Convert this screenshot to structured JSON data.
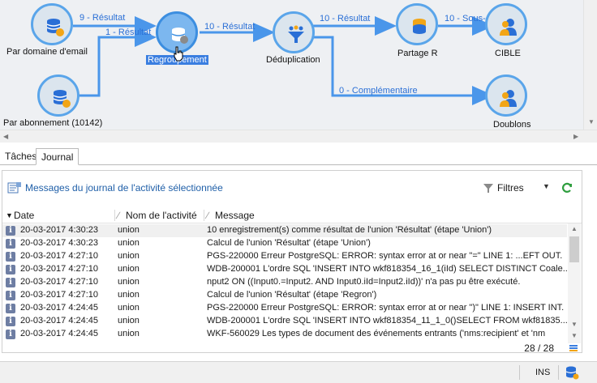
{
  "workflow": {
    "nodes": {
      "par_domaine": "Par domaine d'email",
      "par_abonnement": "Par abonnement (10142)",
      "regroupement": "Regroupement",
      "deduplication": "Déduplication",
      "partage": "Partage R",
      "cible": "CIBLE",
      "doublons": "Doublons"
    },
    "links": {
      "l1": "9 - Résultat",
      "l2": "1 - Résultat",
      "l3": "10 - Résultat",
      "l4": "10 - Résultat",
      "l5": "10 - Sous-e",
      "l6": "0 - Complémentaire"
    },
    "link_color": "#4a96ea"
  },
  "tabs": [
    "Tâches",
    "Journal"
  ],
  "journal": {
    "title": "Messages du journal de l'activité sélectionnée",
    "filters_label": "Filtres",
    "columns": [
      "Date",
      "Nom de l'activité",
      "Message"
    ],
    "rows": [
      {
        "date": "20-03-2017 4:30:23",
        "activity": "union",
        "message": "10 enregistrement(s) comme résultat de l'union 'Résultat' (étape 'Union')"
      },
      {
        "date": "20-03-2017 4:30:23",
        "activity": "union",
        "message": "Calcul de l'union 'Résultat' (étape 'Union')"
      },
      {
        "date": "20-03-2017 4:27:10",
        "activity": "union",
        "message": "PGS-220000 Erreur PostgreSQL: ERROR:  syntax error at or near \"=\" LINE 1: ...EFT OUT."
      },
      {
        "date": "20-03-2017 4:27:10",
        "activity": "union",
        "message": "WDB-200001 L'ordre SQL 'INSERT INTO wkf818354_16_1(iId) SELECT DISTINCT Coale..."
      },
      {
        "date": "20-03-2017 4:27:10",
        "activity": "union",
        "message": "nput2 ON ((Input0.=Input2. AND Input0.iId=Input2.iId))' n'a pas pu être exécuté."
      },
      {
        "date": "20-03-2017 4:27:10",
        "activity": "union",
        "message": "Calcul de l'union 'Résultat' (étape 'Regron')"
      },
      {
        "date": "20-03-2017 4:24:45",
        "activity": "union",
        "message": "PGS-220000 Erreur PostgreSQL: ERROR:  syntax error at or near \")\" LINE 1: INSERT INT."
      },
      {
        "date": "20-03-2017 4:24:45",
        "activity": "union",
        "message": "WDB-200001 L'ordre SQL 'INSERT INTO wkf818354_11_1_0()SELECT  FROM wkf81835..."
      },
      {
        "date": "20-03-2017 4:24:45",
        "activity": "union",
        "message": "WKF-560029 Les types de document des événements entrants ('nms:recipient' et 'nm"
      }
    ],
    "count": "28 / 28"
  },
  "status": {
    "ins": "INS"
  }
}
